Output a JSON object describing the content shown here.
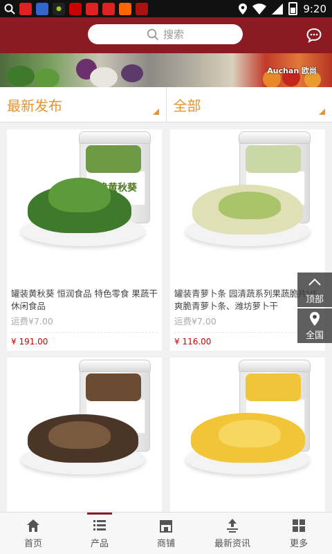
{
  "status_bar": {
    "time": "9:20",
    "app_icons": [
      "search-icon",
      "app-icon-1",
      "baidu-icon",
      "android-icon",
      "app-icon-4",
      "app-icon-5",
      "app-icon-6",
      "taobao-icon",
      "app-icon-8"
    ]
  },
  "header": {
    "search_placeholder": "搜索",
    "chat_icon": "chat-bubble-icon"
  },
  "banner": {
    "brand": "Auchan 欧尚"
  },
  "filters": {
    "left_label": "最新发布",
    "right_label": "全部"
  },
  "products": [
    {
      "title": "罐装黄秋葵 恒润食品 特色零食 果蔬干 休闲食品",
      "shipping": "运费¥7.00",
      "price": "¥ 191.00",
      "jar_text": "爽脆黄秋葵"
    },
    {
      "title": "罐装青萝卜条 园清蔬系列果蔬脆片VF爽脆青萝卜条、潍坊萝卜干",
      "shipping": "运费¥7.00",
      "price": "¥ 116.00",
      "jar_text": ""
    },
    {
      "title": "",
      "shipping": "",
      "price": "",
      "jar_text": ""
    },
    {
      "title": "",
      "shipping": "",
      "price": "",
      "jar_text": ""
    }
  ],
  "side_buttons": {
    "top_label": "顶部",
    "region_label": "全国"
  },
  "bottom_nav": [
    {
      "label": "首页",
      "icon": "home-icon"
    },
    {
      "label": "产品",
      "icon": "list-icon"
    },
    {
      "label": "商铺",
      "icon": "store-icon"
    },
    {
      "label": "最新资讯",
      "icon": "news-icon"
    },
    {
      "label": "更多",
      "icon": "grid-icon"
    }
  ],
  "colors": {
    "header": "#8b1a22",
    "filter_accent": "#e4952d",
    "price": "#cc0000"
  }
}
